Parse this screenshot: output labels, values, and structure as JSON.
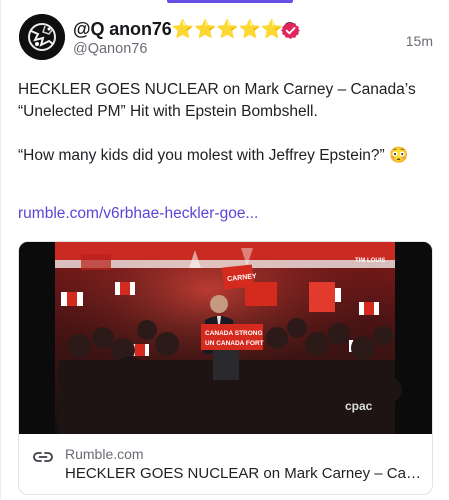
{
  "post": {
    "display_name": "@Q anon76⭐⭐⭐⭐⭐®",
    "handle": "@Qanon76",
    "timestamp": "15m",
    "body_line1": "HECKLER GOES NUCLEAR on Mark Carney – Canada’s “Unelected PM” Hit with Epstein Bombshell.",
    "body_line2": "“How many kids did you molest with Jeffrey Epstein?” 😳",
    "link_text": "rumble.com/v6rbhae-heckler-goe..."
  },
  "card": {
    "domain": "Rumble.com",
    "title": "HECKLER GOES NUCLEAR on Mark Carney – Canada’s “Unelected PM” Hit with Epstein Bombshell",
    "video_watermark": "cpac",
    "sign_banner_line1": "CANADA STRONG",
    "sign_banner_line2": "UN CANADA FORT",
    "sign_carney": "CARNEY",
    "sign_tim": "TIM LOUIS"
  },
  "colors": {
    "accent": "#6a4ee8",
    "link": "#5b45d6",
    "verified_badge": "#e0245e",
    "canada_red": "#d52b1e"
  },
  "icons": {
    "verified": "verified-badge-icon",
    "link": "link-chain-icon"
  }
}
